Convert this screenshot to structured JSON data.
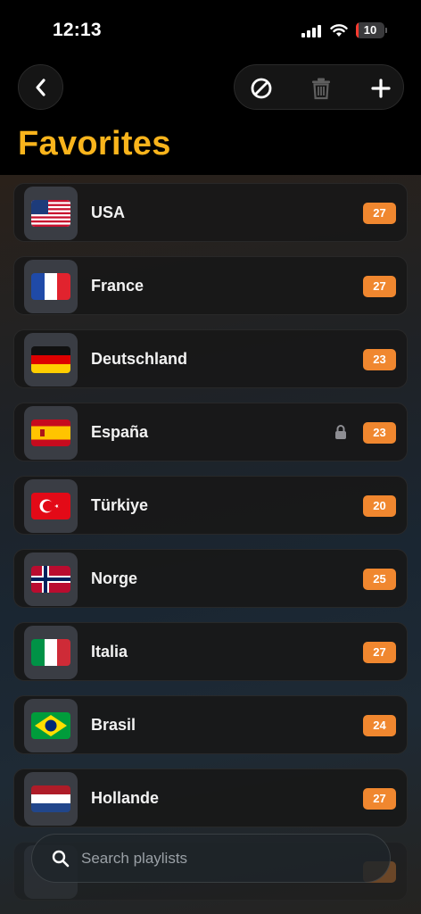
{
  "status_bar": {
    "time": "12:13",
    "battery": "10",
    "battery_level": 0.1
  },
  "header": {
    "title": "Favorites",
    "back_icon": "chevron-left-icon",
    "actions": [
      "block-icon",
      "trash-icon",
      "plus-icon"
    ],
    "accent_color": "#f9b41c"
  },
  "favorites": [
    {
      "name": "USA",
      "count": "27",
      "flag": "us-flag"
    },
    {
      "name": "France",
      "count": "27",
      "flag": "fr-flag"
    },
    {
      "name": "Deutschland",
      "count": "23",
      "flag": "de-flag"
    },
    {
      "name": "España",
      "count": "23",
      "flag": "es-flag",
      "locked": true
    },
    {
      "name": "Türkiye",
      "count": "20",
      "flag": "tr-flag"
    },
    {
      "name": "Norge",
      "count": "25",
      "flag": "no-flag"
    },
    {
      "name": "Italia",
      "count": "27",
      "flag": "it-flag"
    },
    {
      "name": "Brasil",
      "count": "24",
      "flag": "br-flag"
    },
    {
      "name": "Hollande",
      "count": "27",
      "flag": "nl-flag"
    }
  ],
  "badge_color": "#f0872f",
  "search": {
    "placeholder": "Search playlists"
  }
}
